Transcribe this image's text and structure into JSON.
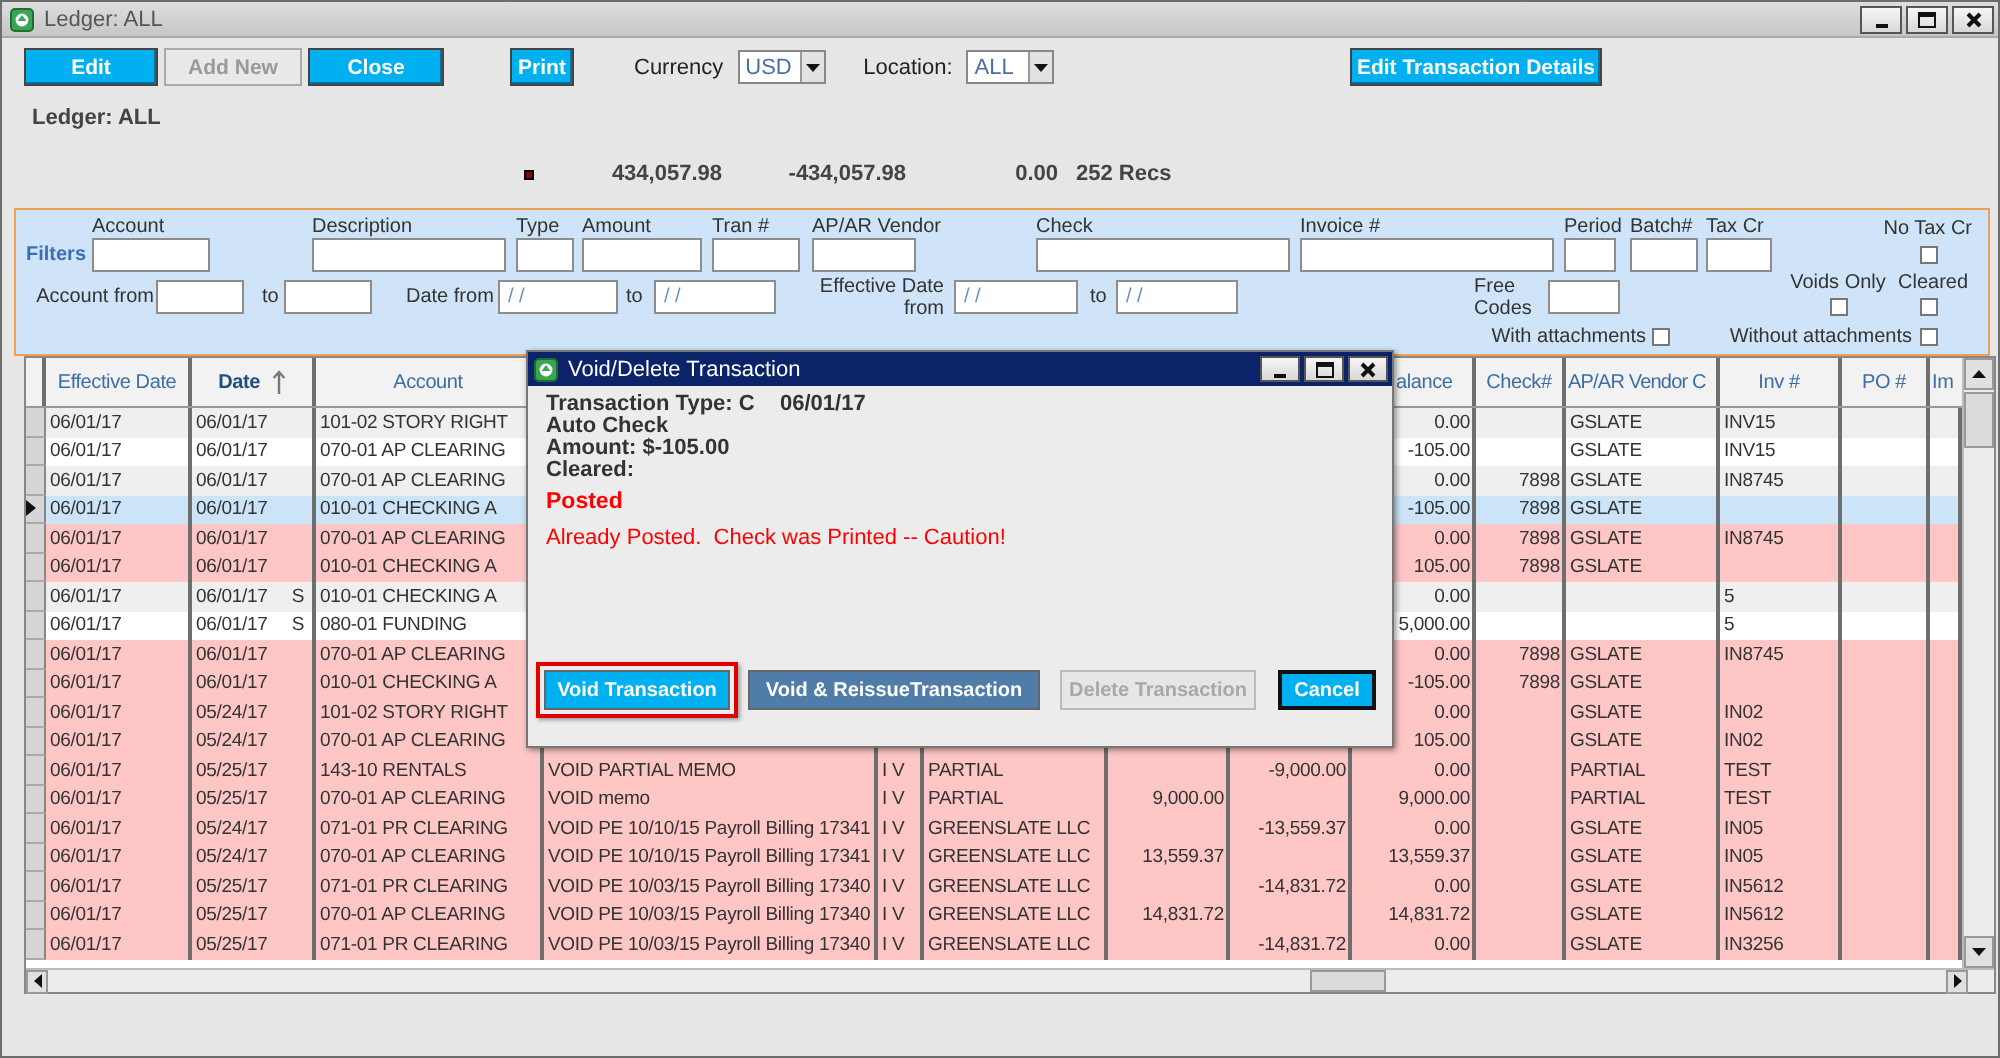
{
  "window": {
    "title": "Ledger: ALL"
  },
  "toolbar": {
    "buttons": [
      {
        "label": "Edit",
        "disabled": false
      },
      {
        "label": "Add New",
        "disabled": true
      },
      {
        "label": "Close",
        "disabled": false
      }
    ],
    "print": {
      "label": "Print"
    },
    "currency": {
      "label": "Currency",
      "value": "USD"
    },
    "location": {
      "label": "Location:",
      "value": "ALL"
    },
    "details_button": {
      "label": "Edit Transaction Details"
    }
  },
  "ledger_label": "Ledger: ALL",
  "summary": {
    "debit_total": "434,057.98",
    "credit_total": "-434,057.98",
    "balance": "0.00",
    "records": "252 Recs"
  },
  "filters": {
    "title": "Filters",
    "fields": [
      {
        "label": "Account"
      },
      {
        "label": "Description"
      },
      {
        "label": "Type"
      },
      {
        "label": "Amount"
      },
      {
        "label": "Tran #"
      },
      {
        "label": "AP/AR Vendor"
      },
      {
        "label": "Check"
      },
      {
        "label": "Invoice #"
      },
      {
        "label": "Period"
      },
      {
        "label": "Batch#"
      },
      {
        "label": "Tax Cr"
      }
    ],
    "account_range": {
      "label": "Account from",
      "to": "to"
    },
    "date_range": {
      "label": "Date from",
      "to": "to",
      "from_value": "/ /",
      "to_value": "/ /"
    },
    "effective_range": {
      "label": "Effective Date from",
      "to": "to",
      "from_value": "/ /",
      "to_value": "/ /"
    },
    "free_codes": {
      "label": "Free Codes"
    },
    "checkboxes": [
      {
        "label": "No Tax Cr",
        "checked": false
      },
      {
        "label": "Voids Only",
        "checked": false
      },
      {
        "label": "Cleared",
        "checked": false
      },
      {
        "label": "With attachments",
        "checked": false
      },
      {
        "label": "Without attachments",
        "checked": false
      }
    ]
  },
  "table": {
    "headers": {
      "effective_date": {
        "label": "Effective Date",
        "sorted": false
      },
      "date": {
        "label": "Date",
        "sorted": true
      },
      "account": {
        "label": "Account",
        "sorted": false
      },
      "balance": {
        "label": "alance",
        "sorted": false
      },
      "check": {
        "label": "Check#",
        "sorted": false
      },
      "vendor_code": {
        "label": "AP/AR Vendor C",
        "sorted": false
      },
      "invoice": {
        "label": "Inv #",
        "sorted": false
      },
      "po": {
        "label": "PO #",
        "sorted": false
      },
      "im": {
        "label": "Im",
        "sorted": false
      }
    },
    "rows": [
      {
        "effective_date": "06/01/17",
        "date": "06/01/17",
        "account": "101-02 STORY RIGHT",
        "balance": "0.00",
        "vendor_code": "GSLATE",
        "invoice": "INV15",
        "selected": false,
        "voided": false
      },
      {
        "effective_date": "06/01/17",
        "date": "06/01/17",
        "account": "070-01 AP CLEARING",
        "balance": "-105.00",
        "vendor_code": "GSLATE",
        "invoice": "INV15",
        "selected": false,
        "voided": false
      },
      {
        "effective_date": "06/01/17",
        "date": "06/01/17",
        "account": "070-01 AP CLEARING",
        "balance": "0.00",
        "check": "7898",
        "vendor_code": "GSLATE",
        "invoice": "IN8745",
        "selected": false,
        "voided": false
      },
      {
        "effective_date": "06/01/17",
        "date": "06/01/17",
        "account": "010-01 CHECKING A",
        "balance": "-105.00",
        "check": "7898",
        "vendor_code": "GSLATE",
        "selected": true,
        "voided": false
      },
      {
        "effective_date": "06/01/17",
        "date": "06/01/17",
        "account": "070-01 AP CLEARING",
        "balance": "0.00",
        "check": "7898",
        "vendor_code": "GSLATE",
        "invoice": "IN8745",
        "selected": false,
        "voided": true
      },
      {
        "effective_date": "06/01/17",
        "date": "06/01/17",
        "account": "010-01 CHECKING A",
        "balance": "105.00",
        "check": "7898",
        "vendor_code": "GSLATE",
        "selected": false,
        "voided": true
      },
      {
        "effective_date": "06/01/17",
        "date": "06/01/17",
        "flag": "S",
        "account": "010-01 CHECKING A",
        "balance": "0.00",
        "invoice": "5",
        "selected": false,
        "voided": false
      },
      {
        "effective_date": "06/01/17",
        "date": "06/01/17",
        "flag": "S",
        "account": "080-01 FUNDING",
        "balance": "5,000.00",
        "invoice": "5",
        "selected": false,
        "voided": false
      },
      {
        "effective_date": "06/01/17",
        "date": "06/01/17",
        "account": "070-01 AP CLEARING",
        "balance": "0.00",
        "check": "7898",
        "vendor_code": "GSLATE",
        "invoice": "IN8745",
        "selected": false,
        "voided": true
      },
      {
        "effective_date": "06/01/17",
        "date": "06/01/17",
        "account": "010-01 CHECKING A",
        "balance": "-105.00",
        "check": "7898",
        "vendor_code": "GSLATE",
        "selected": false,
        "voided": true
      },
      {
        "effective_date": "06/01/17",
        "date": "05/24/17",
        "account": "101-02 STORY RIGHT",
        "balance": "0.00",
        "vendor_code": "GSLATE",
        "invoice": "IN02",
        "selected": false,
        "voided": true
      },
      {
        "effective_date": "06/01/17",
        "date": "05/24/17",
        "account": "070-01 AP CLEARING",
        "balance": "105.00",
        "vendor_code": "GSLATE",
        "invoice": "IN02",
        "selected": false,
        "voided": true
      },
      {
        "effective_date": "06/01/17",
        "date": "05/25/17",
        "account": "143-10 RENTALS",
        "description": "VOID PARTIAL MEMO",
        "type": "I V",
        "vendor": "PARTIAL",
        "credit": "-9,000.00",
        "balance": "0.00",
        "vendor_code": "PARTIAL",
        "invoice": "TEST",
        "selected": false,
        "voided": true
      },
      {
        "effective_date": "06/01/17",
        "date": "05/25/17",
        "account": "070-01 AP CLEARING",
        "description": "VOID memo",
        "type": "I V",
        "vendor": "PARTIAL",
        "debit": "9,000.00",
        "balance": "9,000.00",
        "vendor_code": "PARTIAL",
        "invoice": "TEST",
        "selected": false,
        "voided": true
      },
      {
        "effective_date": "06/01/17",
        "date": "05/24/17",
        "account": "071-01 PR CLEARING",
        "description": "VOID PE 10/10/15 Payroll Billing 17341",
        "type": "I V",
        "vendor": "GREENSLATE LLC",
        "credit": "-13,559.37",
        "balance": "0.00",
        "vendor_code": "GSLATE",
        "invoice": "IN05",
        "selected": false,
        "voided": true
      },
      {
        "effective_date": "06/01/17",
        "date": "05/24/17",
        "account": "070-01 AP CLEARING",
        "description": "VOID PE 10/10/15 Payroll Billing 17341",
        "type": "I V",
        "vendor": "GREENSLATE LLC",
        "debit": "13,559.37",
        "balance": "13,559.37",
        "vendor_code": "GSLATE",
        "invoice": "IN05",
        "selected": false,
        "voided": true
      },
      {
        "effective_date": "06/01/17",
        "date": "05/25/17",
        "account": "071-01 PR CLEARING",
        "description": "VOID PE 10/03/15 Payroll Billing 17340",
        "type": "I V",
        "vendor": "GREENSLATE LLC",
        "credit": "-14,831.72",
        "balance": "0.00",
        "vendor_code": "GSLATE",
        "invoice": "IN5612",
        "selected": false,
        "voided": true
      },
      {
        "effective_date": "06/01/17",
        "date": "05/25/17",
        "account": "070-01 AP CLEARING",
        "description": "VOID PE 10/03/15 Payroll Billing 17340",
        "type": "I V",
        "vendor": "GREENSLATE LLC",
        "debit": "14,831.72",
        "balance": "14,831.72",
        "vendor_code": "GSLATE",
        "invoice": "IN5612",
        "selected": false,
        "voided": true
      },
      {
        "effective_date": "06/01/17",
        "date": "05/25/17",
        "account": "071-01 PR CLEARING",
        "description": "VOID PE 10/03/15 Payroll Billing 17340",
        "type": "I V",
        "vendor": "GREENSLATE LLC",
        "credit": "-14,831.72",
        "balance": "0.00",
        "vendor_code": "GSLATE",
        "invoice": "IN3256",
        "selected": false,
        "voided": true
      }
    ]
  },
  "dialog": {
    "title": "Void/Delete Transaction",
    "type_line": "Transaction Type: C",
    "date": "06/01/17",
    "lines": [
      "Auto Check",
      "Amount: $-105.00",
      "Cleared:"
    ],
    "status": "Posted",
    "warning": "Already Posted.  Check was Printed -- Caution!",
    "buttons": [
      {
        "label": "Void Transaction",
        "kind": "primary",
        "disabled": false,
        "highlighted": true,
        "focused": false
      },
      {
        "label": "Void & ReissueTransaction",
        "kind": "secondary",
        "disabled": false,
        "highlighted": false,
        "focused": false
      },
      {
        "label": "Delete Transaction",
        "kind": "secondary",
        "disabled": true,
        "highlighted": false,
        "focused": false
      },
      {
        "label": "Cancel",
        "kind": "primary",
        "disabled": false,
        "highlighted": false,
        "focused": true
      }
    ]
  }
}
